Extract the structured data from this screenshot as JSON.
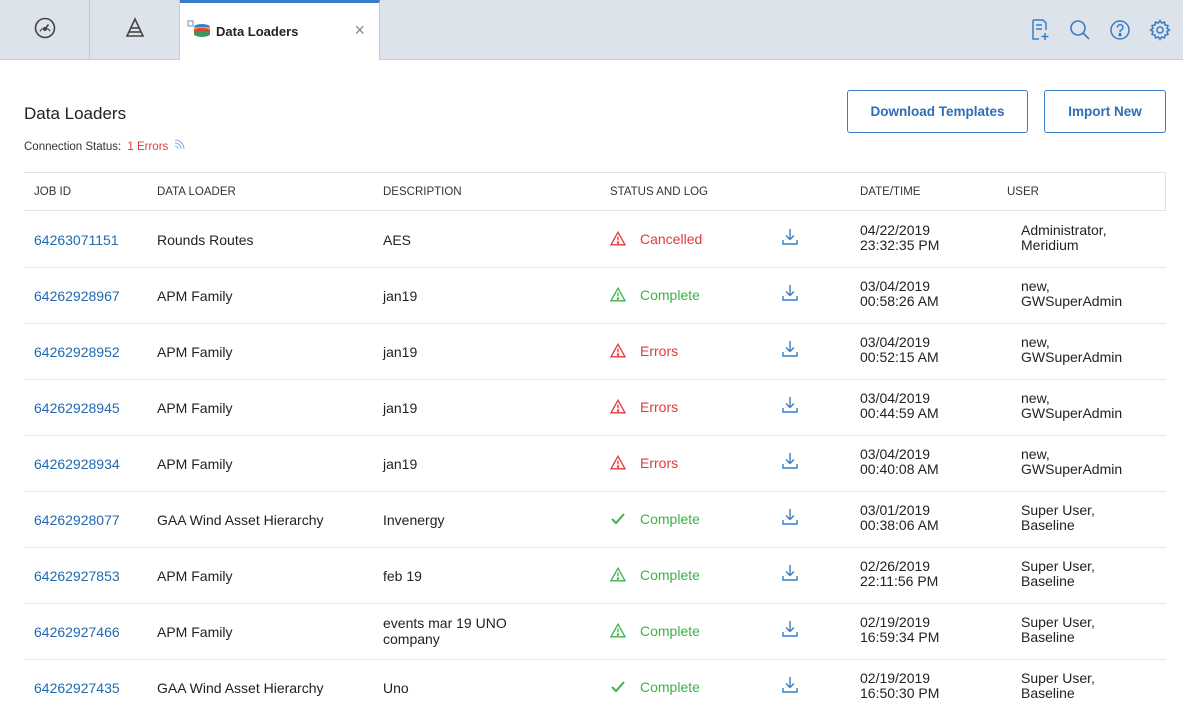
{
  "tabs": {
    "active_label": "Data Loaders",
    "close_glyph": "×"
  },
  "page": {
    "title": "Data Loaders",
    "connection_label": "Connection Status:",
    "connection_value": "1 Errors",
    "download_templates_label": "Download Templates",
    "import_new_label": "Import New"
  },
  "table": {
    "headers": {
      "job_id": "JOB ID",
      "data_loader": "DATA LOADER",
      "description": "DESCRIPTION",
      "status": "STATUS AND LOG",
      "datetime": "DATE/TIME",
      "user": "USER"
    },
    "rows": [
      {
        "job_id": "64263071151",
        "loader": "Rounds Routes",
        "description": "AES",
        "status": "Cancelled",
        "status_icon": "warning-red",
        "date": "04/22/2019",
        "time": "23:32:35 PM",
        "user1": "Administrator,",
        "user2": "Meridium"
      },
      {
        "job_id": "64262928967",
        "loader": "APM Family",
        "description": "jan19",
        "status": "Complete",
        "status_icon": "warning-green",
        "date": "03/04/2019",
        "time": "00:58:26 AM",
        "user1": "new,",
        "user2": "GWSuperAdmin"
      },
      {
        "job_id": "64262928952",
        "loader": "APM Family",
        "description": "jan19",
        "status": "Errors",
        "status_icon": "warning-red",
        "date": "03/04/2019",
        "time": "00:52:15 AM",
        "user1": "new,",
        "user2": "GWSuperAdmin"
      },
      {
        "job_id": "64262928945",
        "loader": "APM Family",
        "description": "jan19",
        "status": "Errors",
        "status_icon": "warning-red",
        "date": "03/04/2019",
        "time": "00:44:59 AM",
        "user1": "new,",
        "user2": "GWSuperAdmin"
      },
      {
        "job_id": "64262928934",
        "loader": "APM Family",
        "description": "jan19",
        "status": "Errors",
        "status_icon": "warning-red",
        "date": "03/04/2019",
        "time": "00:40:08 AM",
        "user1": "new,",
        "user2": "GWSuperAdmin"
      },
      {
        "job_id": "64262928077",
        "loader": "GAA Wind Asset Hierarchy",
        "description": "Invenergy",
        "status": "Complete",
        "status_icon": "check-green",
        "date": "03/01/2019",
        "time": "00:38:06 AM",
        "user1": "Super User,",
        "user2": "Baseline"
      },
      {
        "job_id": "64262927853",
        "loader": "APM Family",
        "description": "feb 19",
        "status": "Complete",
        "status_icon": "warning-green",
        "date": "02/26/2019",
        "time": "22:11:56 PM",
        "user1": "Super User,",
        "user2": "Baseline"
      },
      {
        "job_id": "64262927466",
        "loader": "APM Family",
        "description": "events mar 19 UNO company",
        "status": "Complete",
        "status_icon": "warning-green",
        "date": "02/19/2019",
        "time": "16:59:34 PM",
        "user1": "Super User,",
        "user2": "Baseline"
      },
      {
        "job_id": "64262927435",
        "loader": "GAA Wind Asset Hierarchy",
        "description": "Uno",
        "status": "Complete",
        "status_icon": "check-green",
        "date": "02/19/2019",
        "time": "16:50:30 PM",
        "user1": "Super User,",
        "user2": "Baseline"
      }
    ]
  },
  "colors": {
    "link": "#2369b0",
    "error": "#e03a3a",
    "success": "#3bb24a",
    "accent": "#3a7cc6"
  }
}
